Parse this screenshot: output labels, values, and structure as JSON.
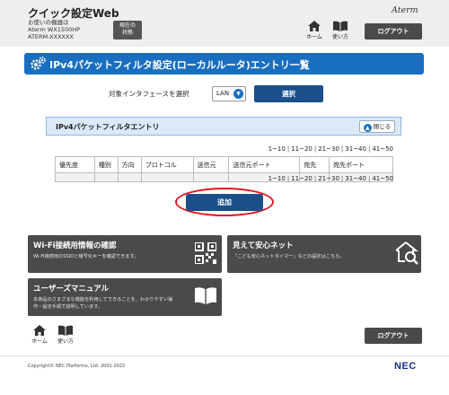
{
  "header": {
    "app_title": "クイック設定Web",
    "device_line1": "お使いの機器は",
    "device_line2": "Aterm WX1500HP",
    "device_line3": "ATERM-XXXXXX",
    "status_line1": "現在の",
    "status_line2": "状態",
    "brand": "Aterm",
    "home_label": "ホーム",
    "howto_label": "使い方",
    "logout_label": "ログアウト"
  },
  "page": {
    "title": "IPv4パケットフィルタ設定(ローカルルータ)エントリ一覧"
  },
  "interface": {
    "label": "対象インタフェースを選択",
    "selected": "LAN",
    "select_button": "選択"
  },
  "section": {
    "title": "IPv4パケットフィルタエントリ",
    "close_label": "閉じる"
  },
  "pagination": {
    "pages": [
      "1~10",
      "11~20",
      "21~30",
      "31~40",
      "41~50"
    ]
  },
  "table": {
    "columns": [
      "優先度",
      "種別",
      "方向",
      "プロトコル",
      "送信元",
      "送信元ポート",
      "宛先",
      "宛先ポート"
    ]
  },
  "add_button": "追加",
  "cards": {
    "wifi": {
      "title": "Wi-Fi接続用情報の確認",
      "desc": "Wi-Fi接続用のSSIDと暗号化キーを確認できます。"
    },
    "safety": {
      "title": "見えて安心ネット",
      "desc": "「こども安心ネットタイマー」などの設定はこちら。"
    },
    "manual": {
      "title": "ユーザーズマニュアル",
      "desc1": "本商品のさまざまな機能を利用してできることを、わかりやすい操",
      "desc2": "作・設定手順で説明しています。"
    }
  },
  "footer": {
    "home_label": "ホーム",
    "howto_label": "使い方",
    "logout_label": "ログアウト",
    "copyright": "Copyright© NEC Platforms, Ltd. 2001-2022",
    "logo": "NEC"
  },
  "colors": {
    "primary_blue": "#1a6ec0",
    "dark_blue": "#1a4f8a",
    "highlight_red": "#e0141e",
    "card_gray": "#4a4a4a"
  }
}
